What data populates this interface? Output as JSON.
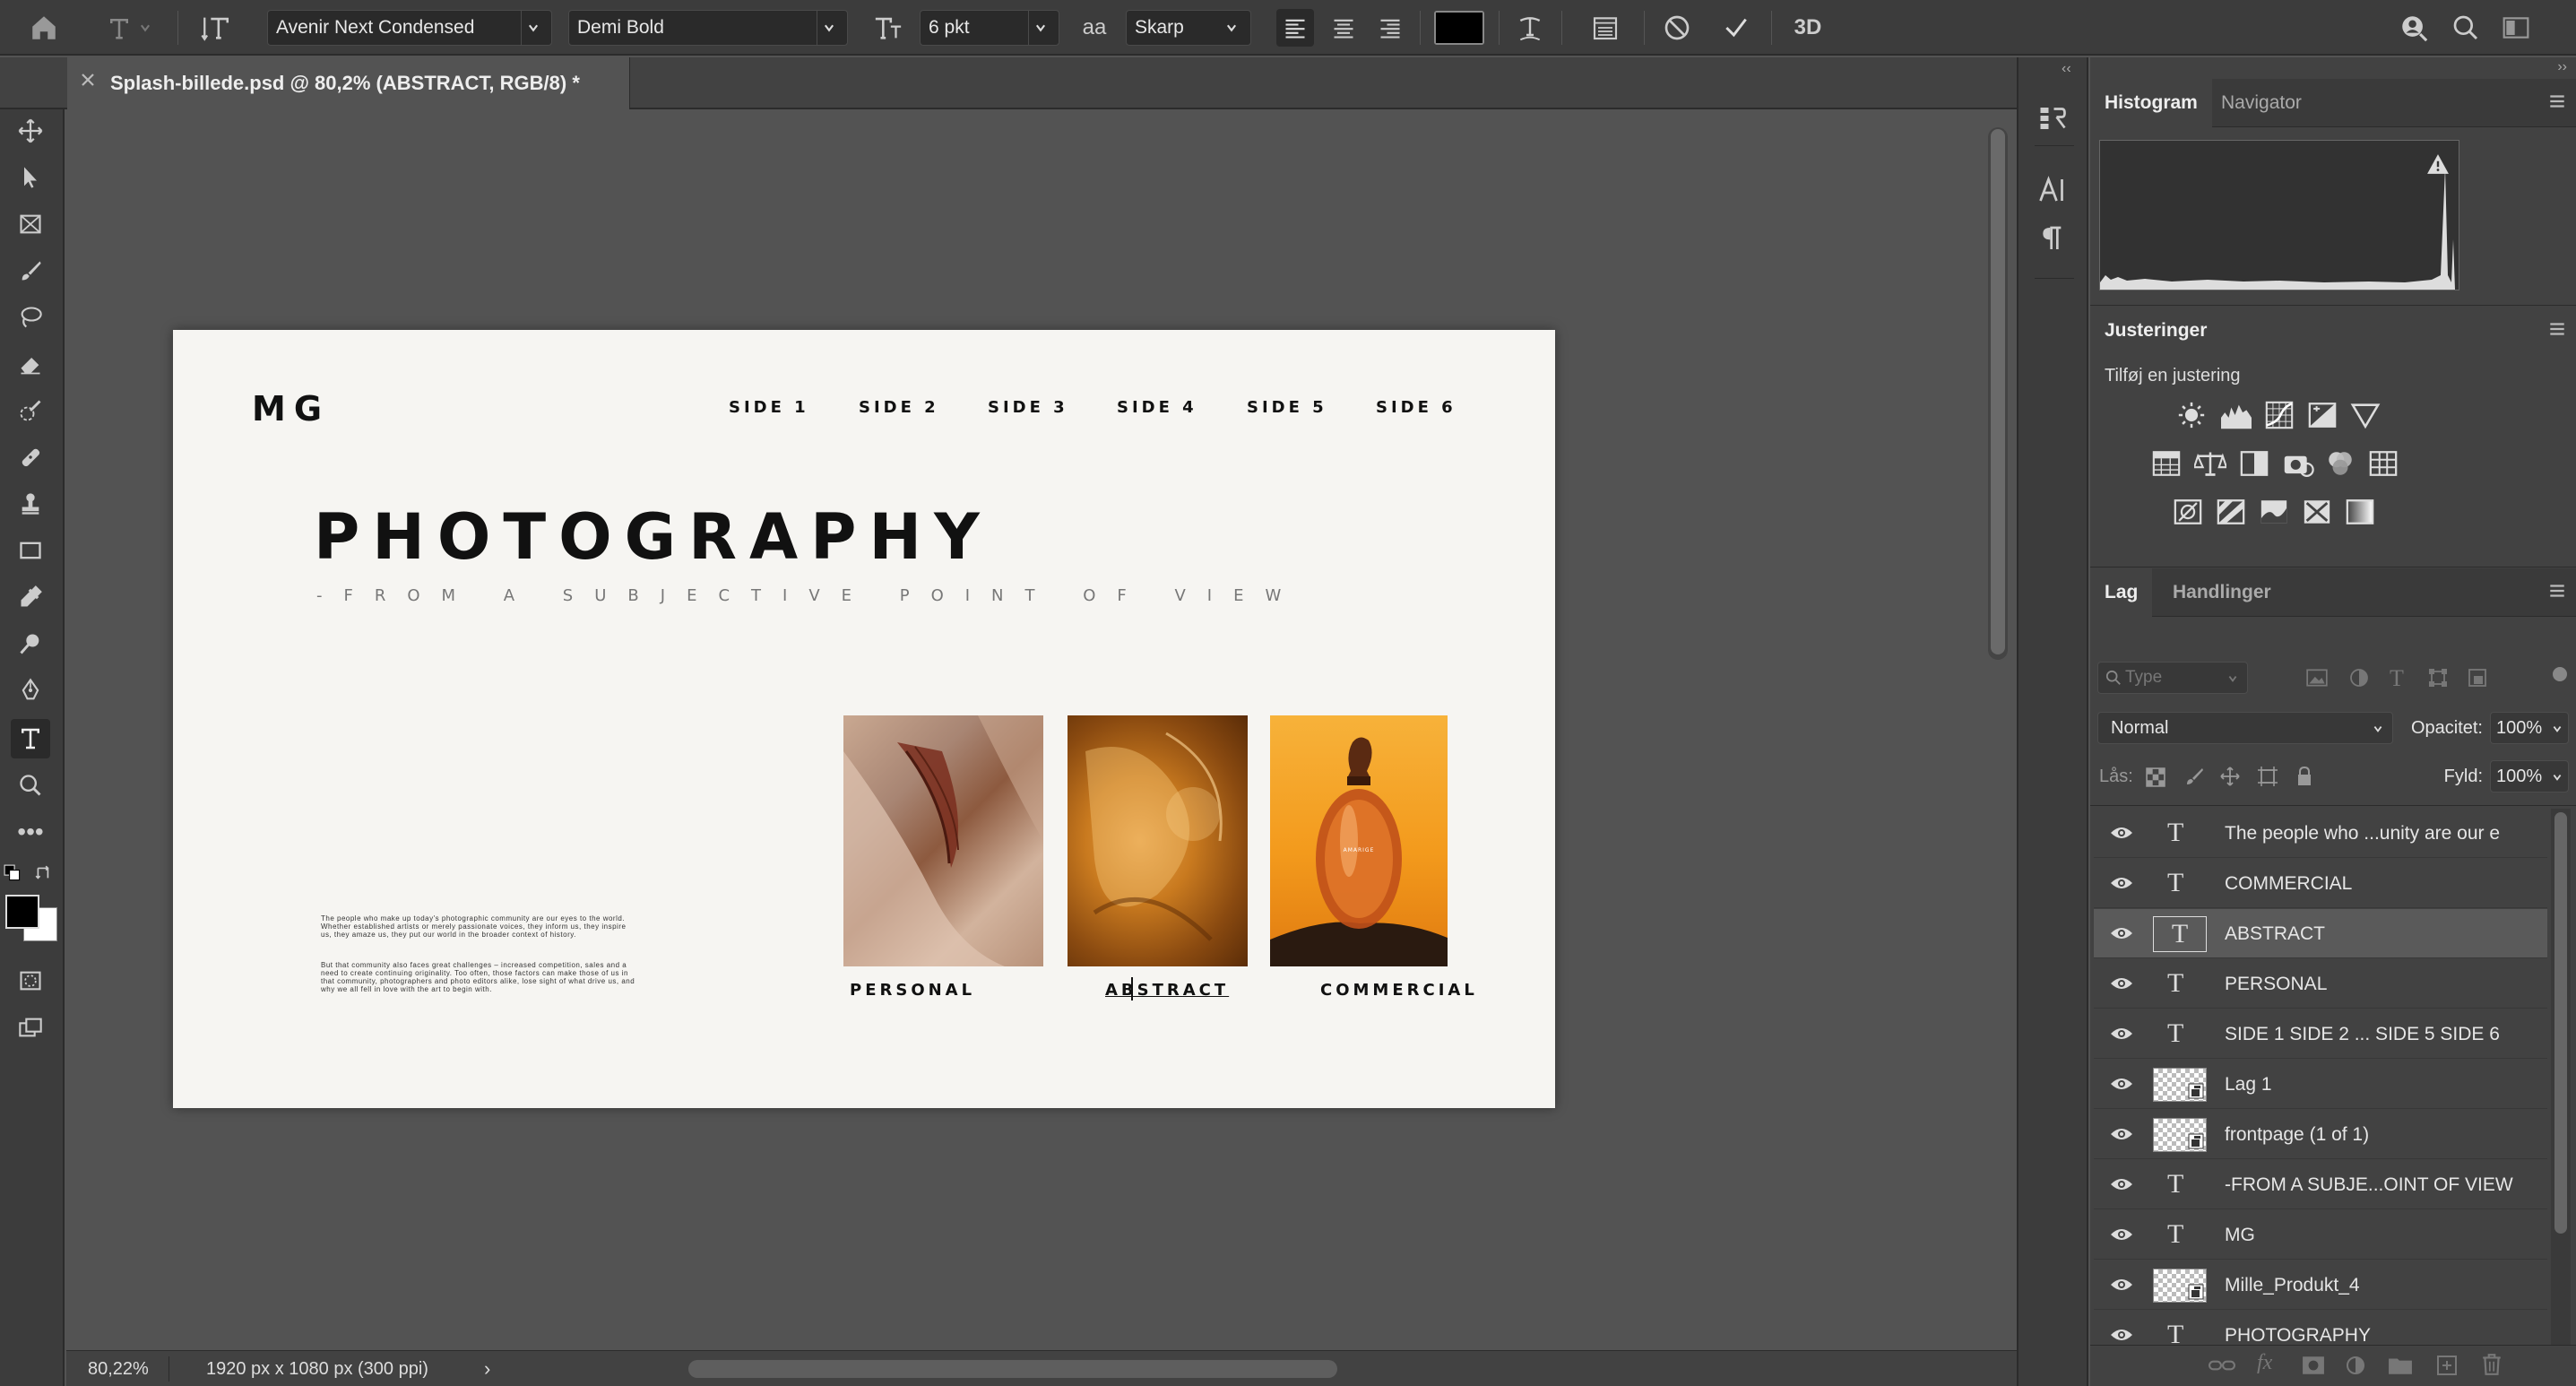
{
  "optionbar": {
    "font_family": "Avenir Next Condensed",
    "font_style": "Demi Bold",
    "font_size": "6 pkt",
    "aa_icon": "aa",
    "antialias": "Skarp",
    "threed": "3D",
    "text_color": "#000000"
  },
  "document": {
    "tab_title": "Splash-billede.psd @ 80,2% (ABSTRACT, RGB/8) *"
  },
  "artboard": {
    "logo": "MG",
    "nav": [
      "SIDE 1",
      "SIDE 2",
      "SIDE 3",
      "SIDE 4",
      "SIDE 5",
      "SIDE 6"
    ],
    "headline": "PHOTOGRAPHY",
    "subheadline": "-FROM A SUBJECTIVE POINT OF VIEW",
    "body_p1": "The people who make up today's photographic community are our eyes to the world. Whether established artists or merely passionate voices, they inform us, they inspire us, they amaze us, they put our world in the broader context of history.",
    "body_p2": "But that community also faces great challenges – increased competition, sales and a need to create continuing originality. Too often, those factors can make those of us in that community, photographers and photo editors alike, lose sight of what drive us, and why we all fell in love with the art to begin with.",
    "captions": [
      "PERSONAL",
      "ABSTRACT",
      "COMMERCIAL"
    ],
    "bottle_label": "AMARIGE"
  },
  "status": {
    "zoom": "80,22%",
    "doc_info": "1920 px x 1080 px (300 ppi)"
  },
  "histogram_panel": {
    "tabs": [
      "Histogram",
      "Navigator"
    ],
    "active_tab": "Histogram"
  },
  "adjustments_panel": {
    "title": "Justeringer",
    "subtitle": "Tilføj en justering"
  },
  "layers_panel": {
    "tabs": [
      "Lag",
      "Handlinger"
    ],
    "filter_placeholder": "Type",
    "blend_mode": "Normal",
    "opacity_label": "Opacitet:",
    "opacity": "100%",
    "lock_label": "Lås:",
    "fill_label": "Fyld:",
    "fill": "100%",
    "layers": [
      {
        "name": "The people who ...unity are our e",
        "kind": "text",
        "selected": false
      },
      {
        "name": "COMMERCIAL",
        "kind": "text",
        "selected": false
      },
      {
        "name": "ABSTRACT",
        "kind": "text",
        "selected": true
      },
      {
        "name": "PERSONAL",
        "kind": "text",
        "selected": false
      },
      {
        "name": "SIDE 1   SIDE 2  ...  SIDE 5   SIDE 6",
        "kind": "text",
        "selected": false
      },
      {
        "name": "Lag 1",
        "kind": "smart",
        "selected": false
      },
      {
        "name": "frontpage (1 of 1)",
        "kind": "smart",
        "selected": false
      },
      {
        "name": "-FROM A SUBJE...OINT OF VIEW",
        "kind": "text",
        "selected": false
      },
      {
        "name": "MG",
        "kind": "text",
        "selected": false
      },
      {
        "name": "Mille_Produkt_4",
        "kind": "smart",
        "selected": false
      },
      {
        "name": "PHOTOGRAPHY",
        "kind": "text",
        "selected": false
      }
    ]
  },
  "colors": {
    "ui_dark": "#3c3c3c",
    "canvas_bg": "#535353",
    "artboard_bg": "#f6f5f2",
    "selected_layer": "#5a5a5a"
  }
}
